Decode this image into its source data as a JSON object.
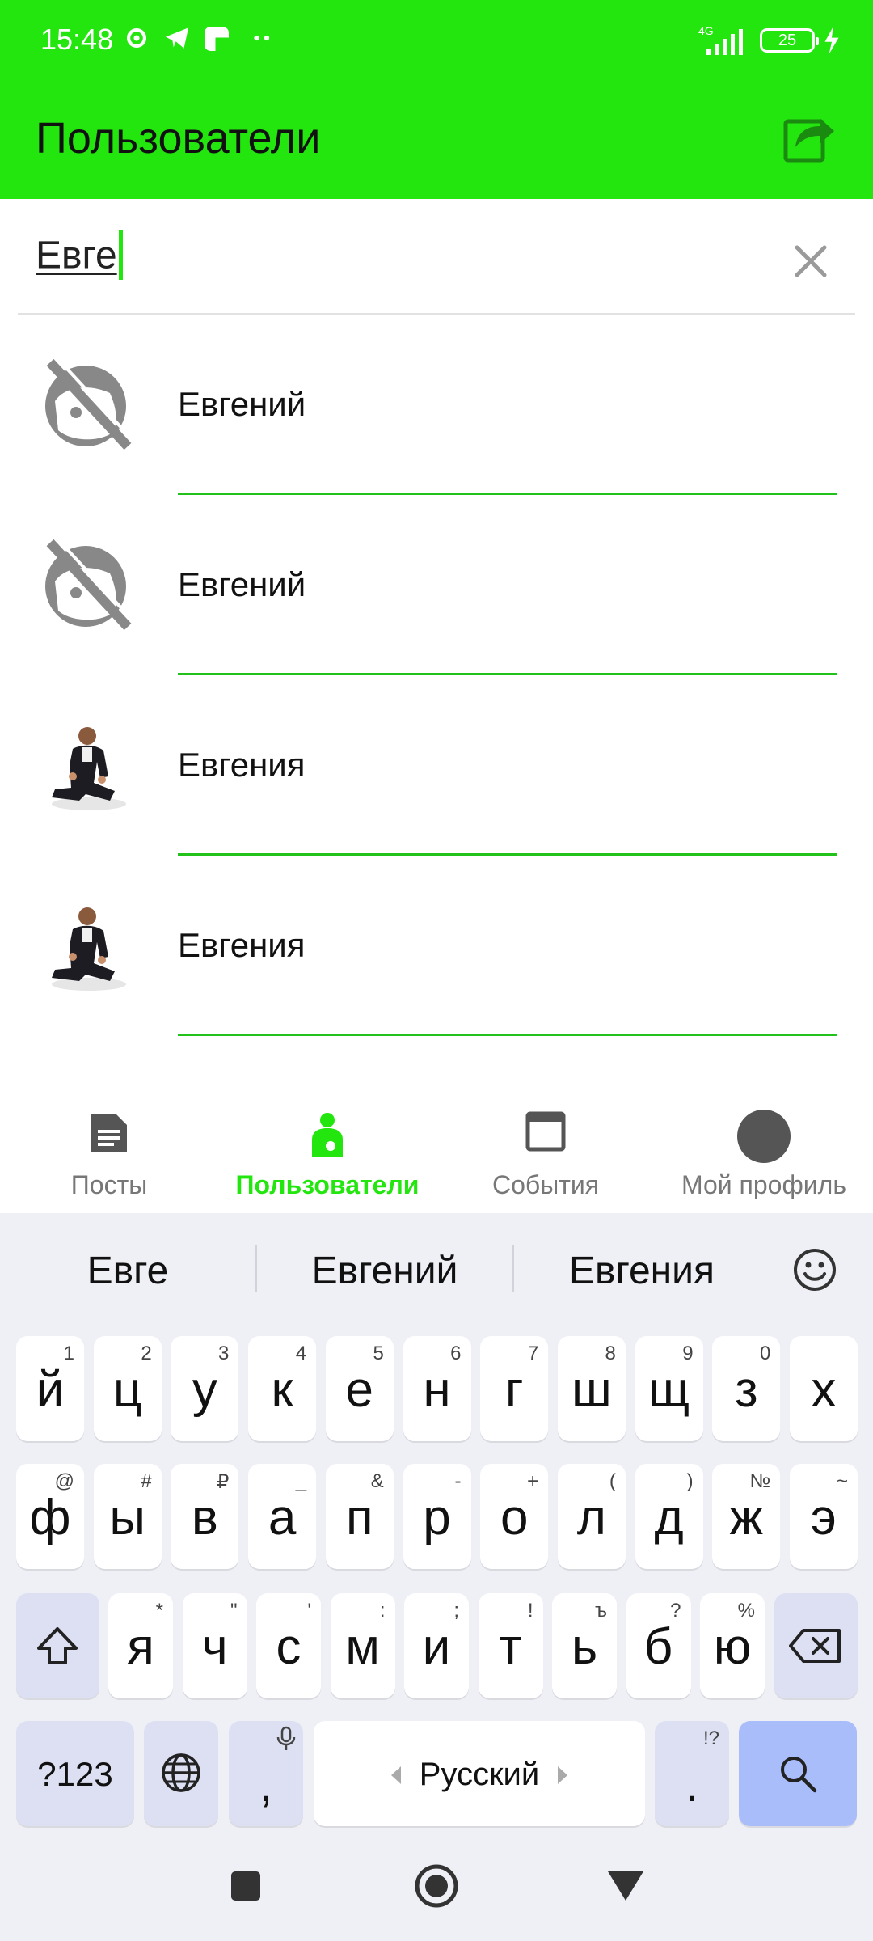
{
  "status_bar": {
    "time": "15:48",
    "network": "4G",
    "battery": "25"
  },
  "app_bar": {
    "title": "Пользователи",
    "share_icon": "share-icon"
  },
  "search": {
    "value": "Евге"
  },
  "results": [
    {
      "name": "Евгений",
      "avatar": "no-photo-icon"
    },
    {
      "name": "Евгений",
      "avatar": "no-photo-icon"
    },
    {
      "name": "Евгения",
      "avatar": "user-photo"
    },
    {
      "name": "Евгения",
      "avatar": "user-photo"
    }
  ],
  "bottom_nav": {
    "items": [
      {
        "label": "Посты",
        "icon": "document-icon",
        "active": false
      },
      {
        "label": "Пользователи",
        "icon": "user-icon",
        "active": true
      },
      {
        "label": "События",
        "icon": "window-icon",
        "active": false
      },
      {
        "label": "Мой профиль",
        "icon": "avatar-circle",
        "active": false
      }
    ]
  },
  "keyboard": {
    "suggestions": [
      "Евге",
      "Евгений",
      "Евгения"
    ],
    "row1": [
      [
        "й",
        "1"
      ],
      [
        "ц",
        "2"
      ],
      [
        "у",
        "3"
      ],
      [
        "к",
        "4"
      ],
      [
        "е",
        "5"
      ],
      [
        "н",
        "6"
      ],
      [
        "г",
        "7"
      ],
      [
        "ш",
        "8"
      ],
      [
        "щ",
        "9"
      ],
      [
        "з",
        "0"
      ],
      [
        "х",
        ""
      ]
    ],
    "row2": [
      [
        "ф",
        "@"
      ],
      [
        "ы",
        "#"
      ],
      [
        "в",
        "₽"
      ],
      [
        "а",
        "_"
      ],
      [
        "п",
        "&"
      ],
      [
        "р",
        "-"
      ],
      [
        "о",
        "+"
      ],
      [
        "л",
        "("
      ],
      [
        "д",
        ")"
      ],
      [
        "ж",
        "№"
      ],
      [
        "э",
        "~"
      ]
    ],
    "row3": [
      [
        "я",
        "*"
      ],
      [
        "ч",
        "\""
      ],
      [
        "с",
        "'"
      ],
      [
        "м",
        ":"
      ],
      [
        "и",
        ";"
      ],
      [
        "т",
        "!"
      ],
      [
        "ь",
        "ъ"
      ],
      [
        "б",
        "?"
      ],
      [
        "ю",
        "%"
      ]
    ],
    "symbols_label": "?123",
    "comma_label": ",",
    "space_label": "Русский",
    "period_label": ".",
    "period_hint": "!?"
  },
  "colors": {
    "accent": "#22e60e",
    "divider": "#22c21a",
    "keyboard_bg": "#eff0f6",
    "func_key": "#dde0f3",
    "search_key": "#aabdfb"
  }
}
